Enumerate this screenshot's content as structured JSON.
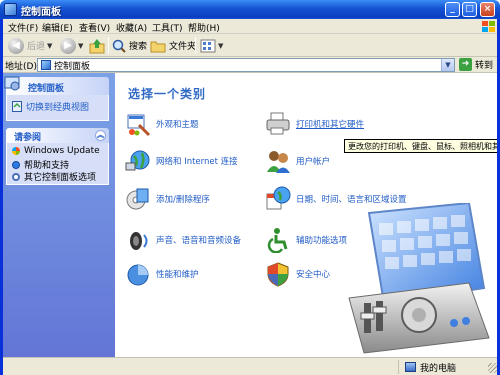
{
  "window": {
    "title": "控制面板"
  },
  "menu": [
    "文件(F)",
    "编辑(E)",
    "查看(V)",
    "收藏(A)",
    "工具(T)",
    "帮助(H)"
  ],
  "toolbar": {
    "back": "后退",
    "search": "搜索",
    "folders": "文件夹"
  },
  "address": {
    "label": "地址(D)",
    "value": "控制面板",
    "go": "转到"
  },
  "sidebar": {
    "primary": {
      "title": "控制面板",
      "link": "切换到经典视图"
    },
    "see_also": {
      "title": "请参阅",
      "items": [
        "Windows Update",
        "帮助和支持",
        "其它控制面板选项"
      ]
    }
  },
  "content": {
    "heading": "选择一个类别",
    "categories": [
      "外观和主题",
      "网络和 Internet 连接",
      "添加/删除程序",
      "声音、语音和音频设备",
      "性能和维护",
      "打印机和其它硬件",
      "用户帐户",
      "日期、时间、语言和区域设置",
      "辅助功能选项",
      "安全中心"
    ],
    "tooltip": "更改您的打印机、键盘、鼠标、照相机和其它硬"
  },
  "status": {
    "location": "我的电脑"
  },
  "colors": {
    "link": "#215dc6",
    "heading": "#316ac5",
    "titlebar": "#0a3fc0",
    "sidebar": "#7ba2e7"
  }
}
